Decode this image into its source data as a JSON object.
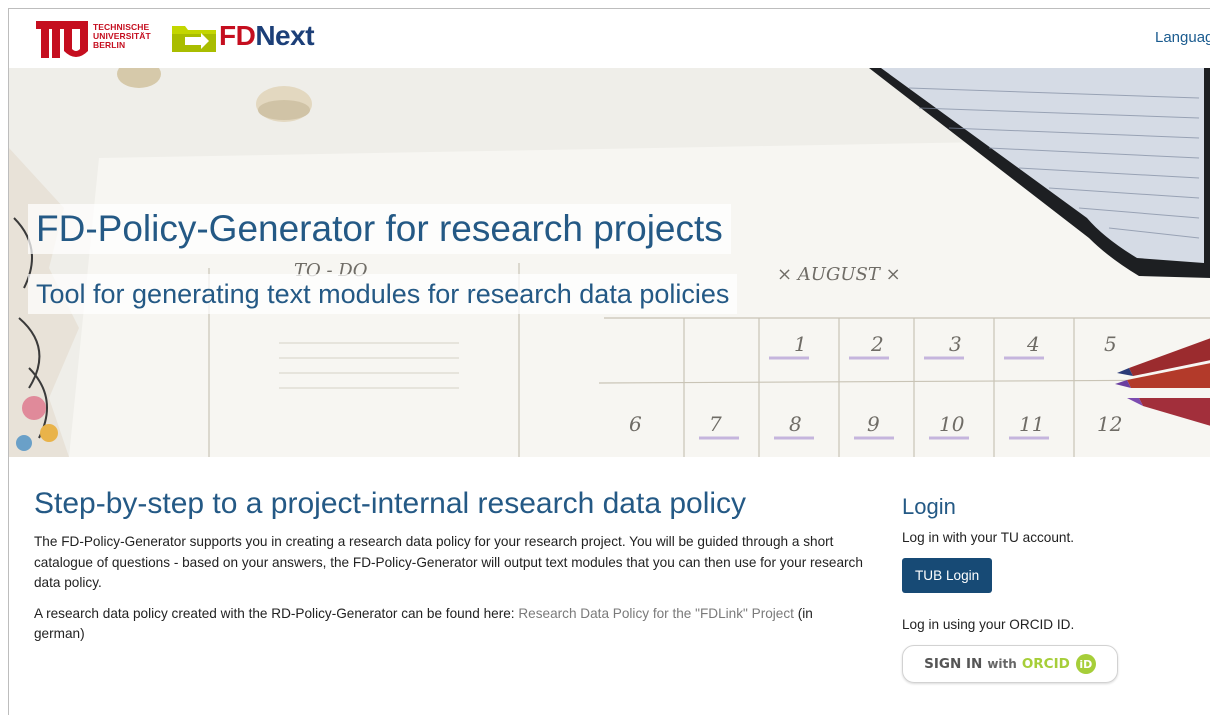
{
  "header": {
    "tu_logo_text": [
      "TECHNISCHE",
      "UNIVERSITÄT",
      "BERLIN"
    ],
    "app_name_prefix": "FD",
    "app_name_suffix": "Next",
    "language_label": "Languag"
  },
  "hero": {
    "title": "FD-Policy-Generator for research projects",
    "subtitle": "Tool for generating text modules for research data policies",
    "calendar_numbers_row1": [
      "1",
      "2",
      "3",
      "4",
      "5"
    ],
    "calendar_numbers_row2": [
      "6",
      "7",
      "8",
      "9",
      "10",
      "11",
      "12"
    ],
    "notepad_text": "TO - DO",
    "month_text": "× AUGUST ×"
  },
  "main": {
    "heading": "Step-by-step to a project-internal research data policy",
    "paragraph1": "The FD-Policy-Generator supports you in creating a research data policy for your research project. You will be guided through a short catalogue of questions - based on your answers, the FD-Policy-Generator will output text modules that you can then use for your research data policy.",
    "paragraph2_prefix": "A research data policy created with the RD-Policy-Generator can be found here: ",
    "paragraph2_link": "Research Data Policy for the \"FDLink\" Project",
    "paragraph2_suffix": " (in german)"
  },
  "login": {
    "heading": "Login",
    "tu_text": "Log in with your TU account.",
    "tub_button": "TUB Login",
    "orcid_text": "Log in using your ORCID ID.",
    "orcid_button_signin": "SIGN IN",
    "orcid_button_with": "with",
    "orcid_button_orcid": "ORCID",
    "orcid_icon": "iD"
  },
  "colors": {
    "tu_red": "#c50e1f",
    "brand_blue": "#245985",
    "button_blue": "#174a75",
    "orcid_green": "#a6ce39"
  }
}
